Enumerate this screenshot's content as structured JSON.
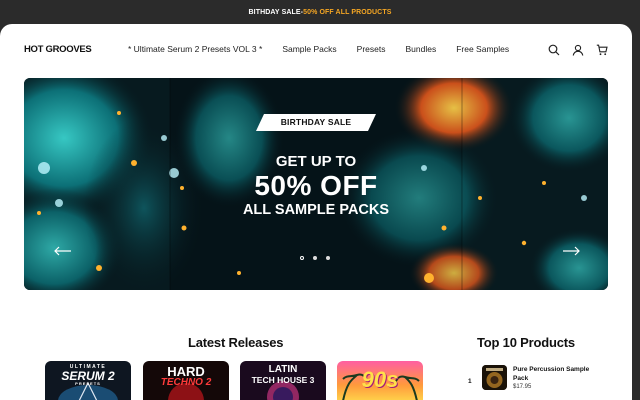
{
  "announcement": {
    "prefix": "BITHDAY SALE- ",
    "highlight": "50% OFF ALL PRODUCTS"
  },
  "header": {
    "logo": "HOT GROOVES",
    "nav": [
      "* Ultimate Serum 2 Presets VOL 3 *",
      "Sample Packs",
      "Presets",
      "Bundles",
      "Free Samples"
    ],
    "icons": [
      "search-icon",
      "account-icon",
      "cart-icon"
    ]
  },
  "hero": {
    "badge": "BIRTHDAY SALE",
    "line1": "GET UP TO",
    "line2": "50% OFF",
    "line3": "ALL SAMPLE PACKS",
    "slides_total": 3,
    "active_slide": 1
  },
  "latest": {
    "title": "Latest Releases",
    "covers": [
      {
        "top": "ULTIMATE",
        "main": "SERUM 2",
        "sub": "PRESETS"
      },
      {
        "top": "",
        "main": "HARD",
        "sub": "TECHNO 2"
      },
      {
        "top": "LATIN",
        "main": "TECH HOUSE 3",
        "sub": ""
      },
      {
        "top": "",
        "main": "90s",
        "sub": ""
      }
    ]
  },
  "top_products": {
    "title": "Top 10 Products",
    "items": [
      {
        "rank": "1",
        "name": "Pure Percussion Sample Pack",
        "price": "$17.95"
      }
    ]
  },
  "colors": {
    "accent": "#f5a623",
    "dark": "#2b2b2b"
  }
}
